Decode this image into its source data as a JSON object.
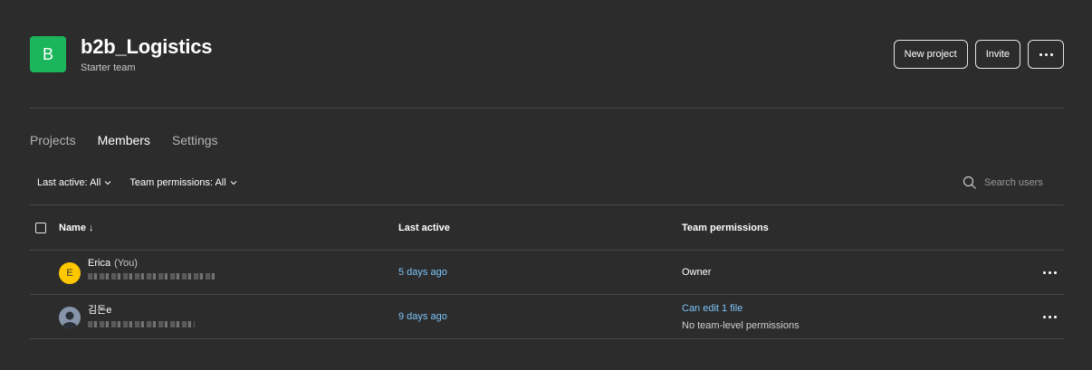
{
  "team": {
    "initial": "B",
    "name": "b2b_Logistics",
    "plan": "Starter team",
    "logo_color": "#1bb55c"
  },
  "actions": {
    "new_project": "New project",
    "invite": "Invite",
    "more_icon": "ellipsis-icon"
  },
  "tabs": [
    {
      "label": "Projects",
      "active": false
    },
    {
      "label": "Members",
      "active": true
    },
    {
      "label": "Settings",
      "active": false
    }
  ],
  "filters": {
    "last_active": "Last active: All",
    "team_permissions": "Team permissions: All"
  },
  "search": {
    "placeholder": "Search users",
    "icon": "search-icon"
  },
  "table": {
    "columns": {
      "name": "Name ↓",
      "last_active": "Last active",
      "team_permissions": "Team permissions"
    },
    "rows": [
      {
        "avatar_initial": "E",
        "name": "Erica",
        "you_label": "(You)",
        "last_active": "5 days ago",
        "permission": "Owner"
      },
      {
        "avatar_initial": "",
        "name": "김돈e",
        "last_active": "9 days ago",
        "permission_link": "Can edit 1 file",
        "permission_note": "No team-level permissions"
      }
    ]
  },
  "colors": {
    "background": "#2c2c2c",
    "link": "#7cc4f8",
    "avatar_yellow": "#ffc700"
  }
}
